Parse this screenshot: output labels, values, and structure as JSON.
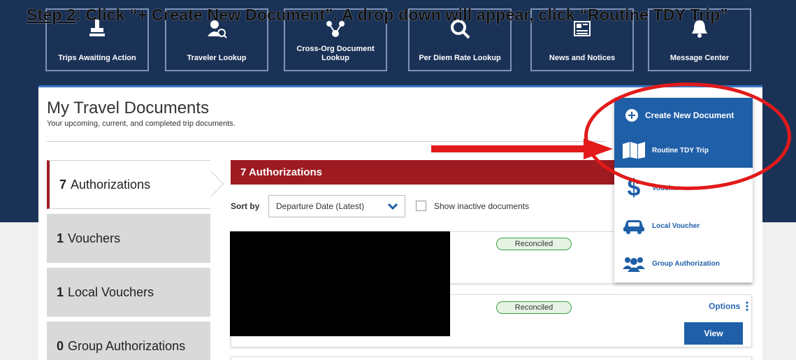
{
  "instruction": {
    "step_label": "Step 2",
    "text": ": Click “+ Create New Document”. A drop down will appear, click “Routine TDY Trip”"
  },
  "nav_tiles": [
    {
      "label": "Trips Awaiting Action",
      "icon": "stamp-icon"
    },
    {
      "label": "Traveler Lookup",
      "icon": "person-search-icon"
    },
    {
      "label": "Cross-Org Document Lookup",
      "icon": "network-icon"
    },
    {
      "label": "Per Diem Rate Lookup",
      "icon": "magnifier-icon"
    },
    {
      "label": "News and Notices",
      "icon": "newspaper-icon"
    },
    {
      "label": "Message Center",
      "icon": "bell-icon"
    }
  ],
  "page": {
    "title": "My Travel Documents",
    "subtitle": "Your upcoming, current, and completed trip documents."
  },
  "side_tabs": [
    {
      "count": "7",
      "label": "Authorizations",
      "active": true
    },
    {
      "count": "1",
      "label": "Vouchers",
      "active": false
    },
    {
      "count": "1",
      "label": "Local Vouchers",
      "active": false
    },
    {
      "count": "0",
      "label": "Group Authorizations",
      "active": false
    }
  ],
  "documents_header": "7 Authorizations",
  "sort": {
    "label": "Sort by",
    "selected": "Departure Date (Latest)"
  },
  "inactive_toggle": {
    "label": "Show inactive documents",
    "checked": false
  },
  "documents": [
    {
      "status": "Reconciled"
    },
    {
      "status": "Reconciled",
      "options_label": "Options",
      "view_label": "View"
    }
  ],
  "create_menu": {
    "button_label": "Create New Document",
    "items": [
      {
        "label": "Routine TDY Trip",
        "icon": "map-icon",
        "highlighted": true
      },
      {
        "label": "Voucher",
        "icon": "dollar-icon",
        "highlighted": false
      },
      {
        "label": "Local Voucher",
        "icon": "car-icon",
        "highlighted": false
      },
      {
        "label": "Group Authorization",
        "icon": "group-icon",
        "highlighted": false
      }
    ]
  },
  "colors": {
    "navy": "#1b3257",
    "accent_blue": "#1f5fa8",
    "auth_red": "#9e1b21",
    "annotation_red": "#e21a1a",
    "status_green": "#39a043"
  }
}
